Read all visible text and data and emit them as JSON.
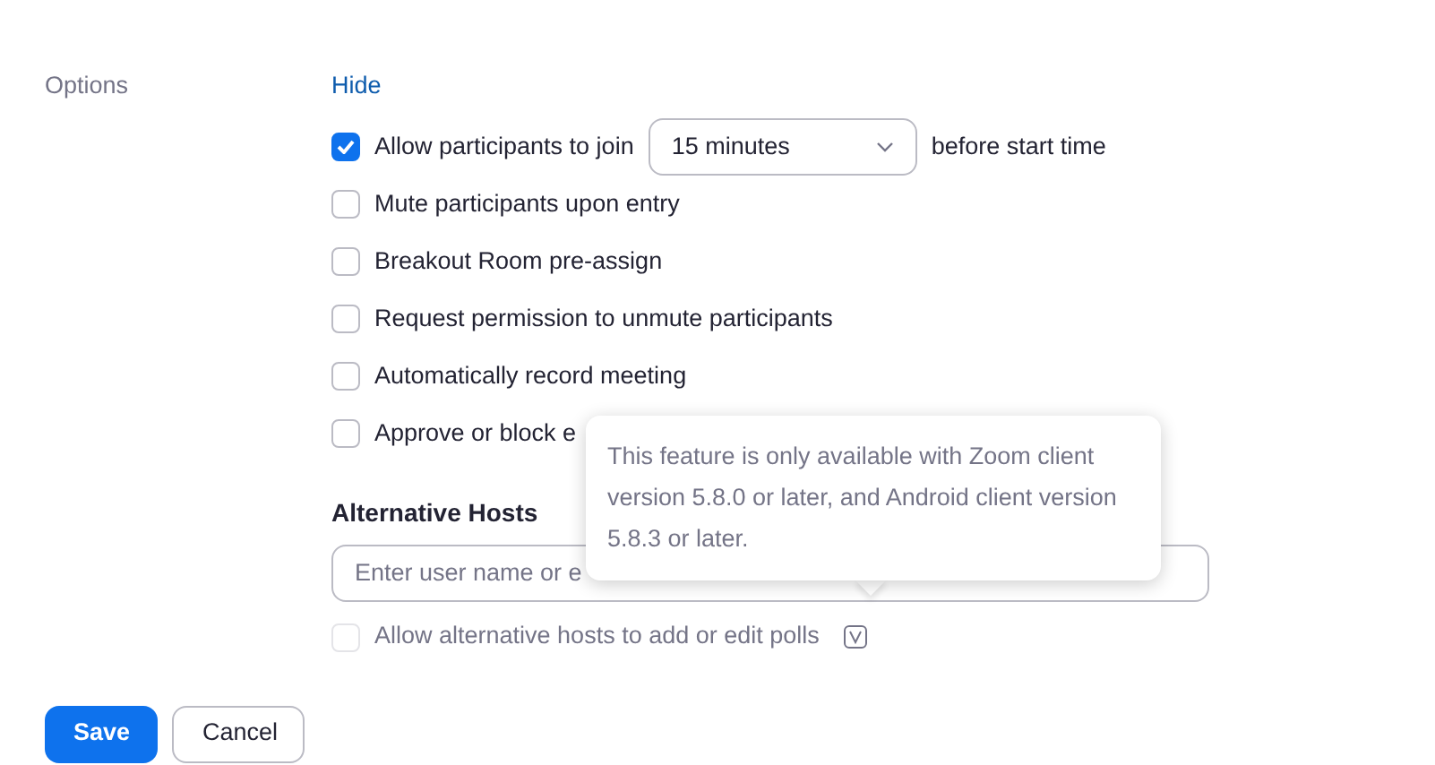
{
  "options_label": "Options",
  "hide_link": "Hide",
  "options": [
    {
      "kind": "select",
      "label": "Allow participants to join",
      "checked": true,
      "select_value": "15 minutes",
      "suffix": "before start time"
    },
    {
      "kind": "plain",
      "label": "Mute participants upon entry",
      "checked": false
    },
    {
      "kind": "plain",
      "label": "Breakout Room pre-assign",
      "checked": false
    },
    {
      "kind": "plain",
      "label": "Request permission to unmute participants",
      "checked": false
    },
    {
      "kind": "plain",
      "label": "Automatically record meeting",
      "checked": false
    },
    {
      "kind": "plain",
      "label": "Approve or block e",
      "checked": false
    }
  ],
  "alternative_hosts": {
    "heading": "Alternative Hosts",
    "placeholder": "Enter user name or e",
    "polls": {
      "label": "Allow alternative hosts to add or edit polls",
      "checked": false,
      "disabled": true
    }
  },
  "tooltip": "This feature is only available with Zoom client version 5.8.0 or later, and Android client version 5.8.3 or later.",
  "buttons": [
    {
      "label": "Save",
      "kind": "primary"
    },
    {
      "label": "Cancel",
      "kind": "secondary"
    }
  ]
}
